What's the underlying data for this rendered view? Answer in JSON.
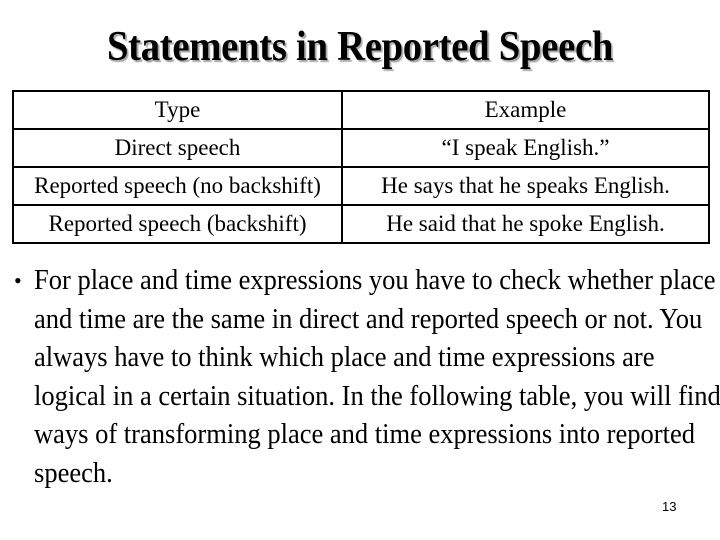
{
  "slide": {
    "title": "Statements in Reported Speech",
    "table": {
      "headers": [
        "Type",
        "Example"
      ],
      "rows": [
        [
          "Direct speech",
          "“I speak English.”"
        ],
        [
          "Reported speech (no backshift)",
          "He says that he speaks English."
        ],
        [
          "Reported speech (backshift)",
          "He said that he spoke English."
        ]
      ]
    },
    "bullet": {
      "symbol": "•",
      "text": "For place and time expressions you have to check whether place and time are the same in direct and reported speech or not. You always have to think which place and time expressions are logical in a certain situation. In the following table, you will find ways of transforming place and time expressions into reported speech."
    },
    "page_number": "13"
  }
}
